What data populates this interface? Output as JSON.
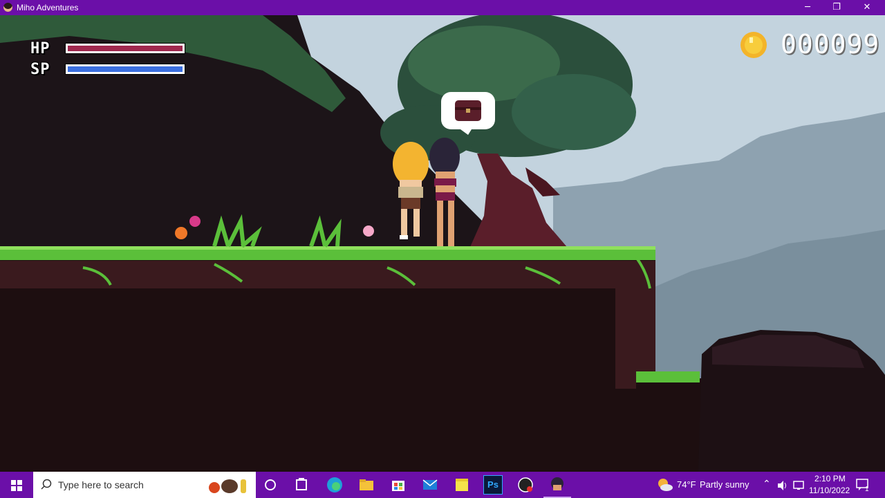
{
  "window": {
    "title": "Miho Adventures",
    "controls": {
      "minimize": "─",
      "restore": "❐",
      "close": "✕"
    }
  },
  "hud": {
    "hp_label": "HP",
    "sp_label": "SP",
    "hp_fill": 1.0,
    "sp_fill": 1.0,
    "hp_color": "#a0284e",
    "sp_color": "#3b6fe0",
    "coin_icon": "gold-coin-icon",
    "coin_count": "000099"
  },
  "scene": {
    "interaction_bubble_icon": "treasure-chest-icon",
    "characters": [
      "blonde-heroine",
      "dark-haired-heroine"
    ]
  },
  "taskbar": {
    "search_placeholder": "Type here to search",
    "pinned": [
      "cortana-icon",
      "task-view-icon",
      "edge-icon",
      "file-explorer-icon",
      "store-icon",
      "mail-icon",
      "sticky-notes-icon",
      "photoshop-icon",
      "obs-icon",
      "miho-adventures-icon"
    ],
    "photoshop_label": "Ps",
    "weather": {
      "temp": "74°F",
      "condition": "Partly sunny"
    },
    "clock": {
      "time": "2:10 PM",
      "date": "11/10/2022"
    },
    "notification_count": "1"
  },
  "colors": {
    "accent": "#6b0fa8",
    "grass": "#5bbf3a",
    "dirt": "#2a1012",
    "sky": "#c3d3de"
  }
}
